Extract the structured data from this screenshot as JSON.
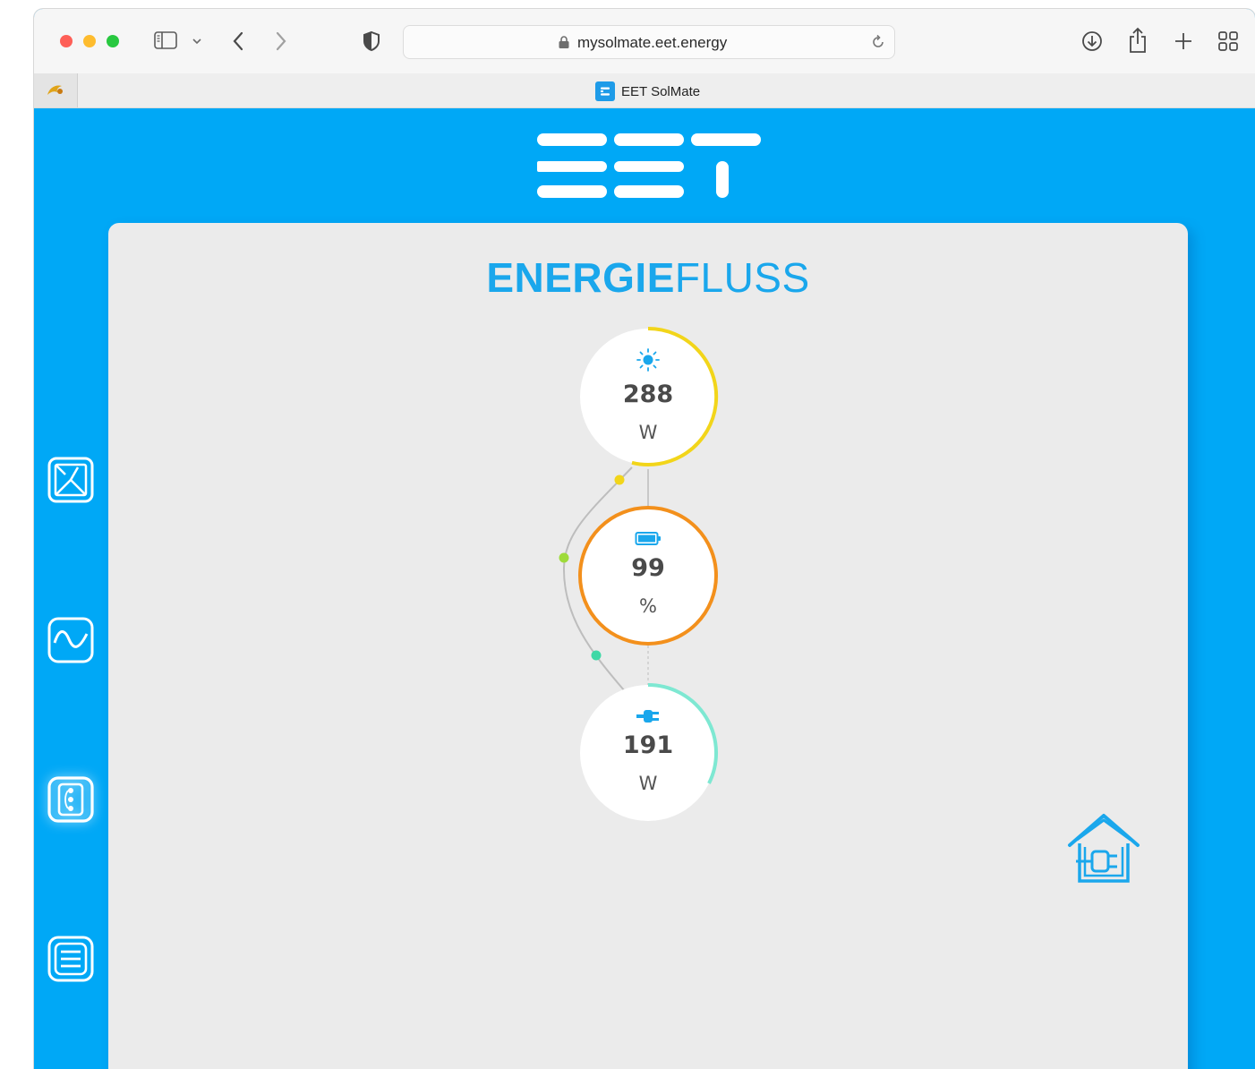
{
  "browser": {
    "url": "mysolmate.eet.energy",
    "tab_title": "EET SolMate"
  },
  "app": {
    "logo_text": "EET",
    "title_bold": "ENERGIE",
    "title_light": "FLUSS",
    "accent_color": "#00a8f6",
    "nav": [
      {
        "icon": "dashboard-icon"
      },
      {
        "icon": "wave-chart-icon"
      },
      {
        "icon": "energy-flow-icon",
        "active": true
      },
      {
        "icon": "menu-list-icon"
      }
    ]
  },
  "flow": {
    "solar": {
      "value": "288",
      "unit": "W",
      "icon": "sun-icon",
      "color": "#f2d51a"
    },
    "battery": {
      "value": "99",
      "unit": "%",
      "icon": "battery-icon",
      "color": "#f3901c"
    },
    "grid": {
      "value": "191",
      "unit": "W",
      "icon": "plug-icon",
      "color": "#7ee8d2"
    },
    "house_icon": "house-plug-icon"
  }
}
